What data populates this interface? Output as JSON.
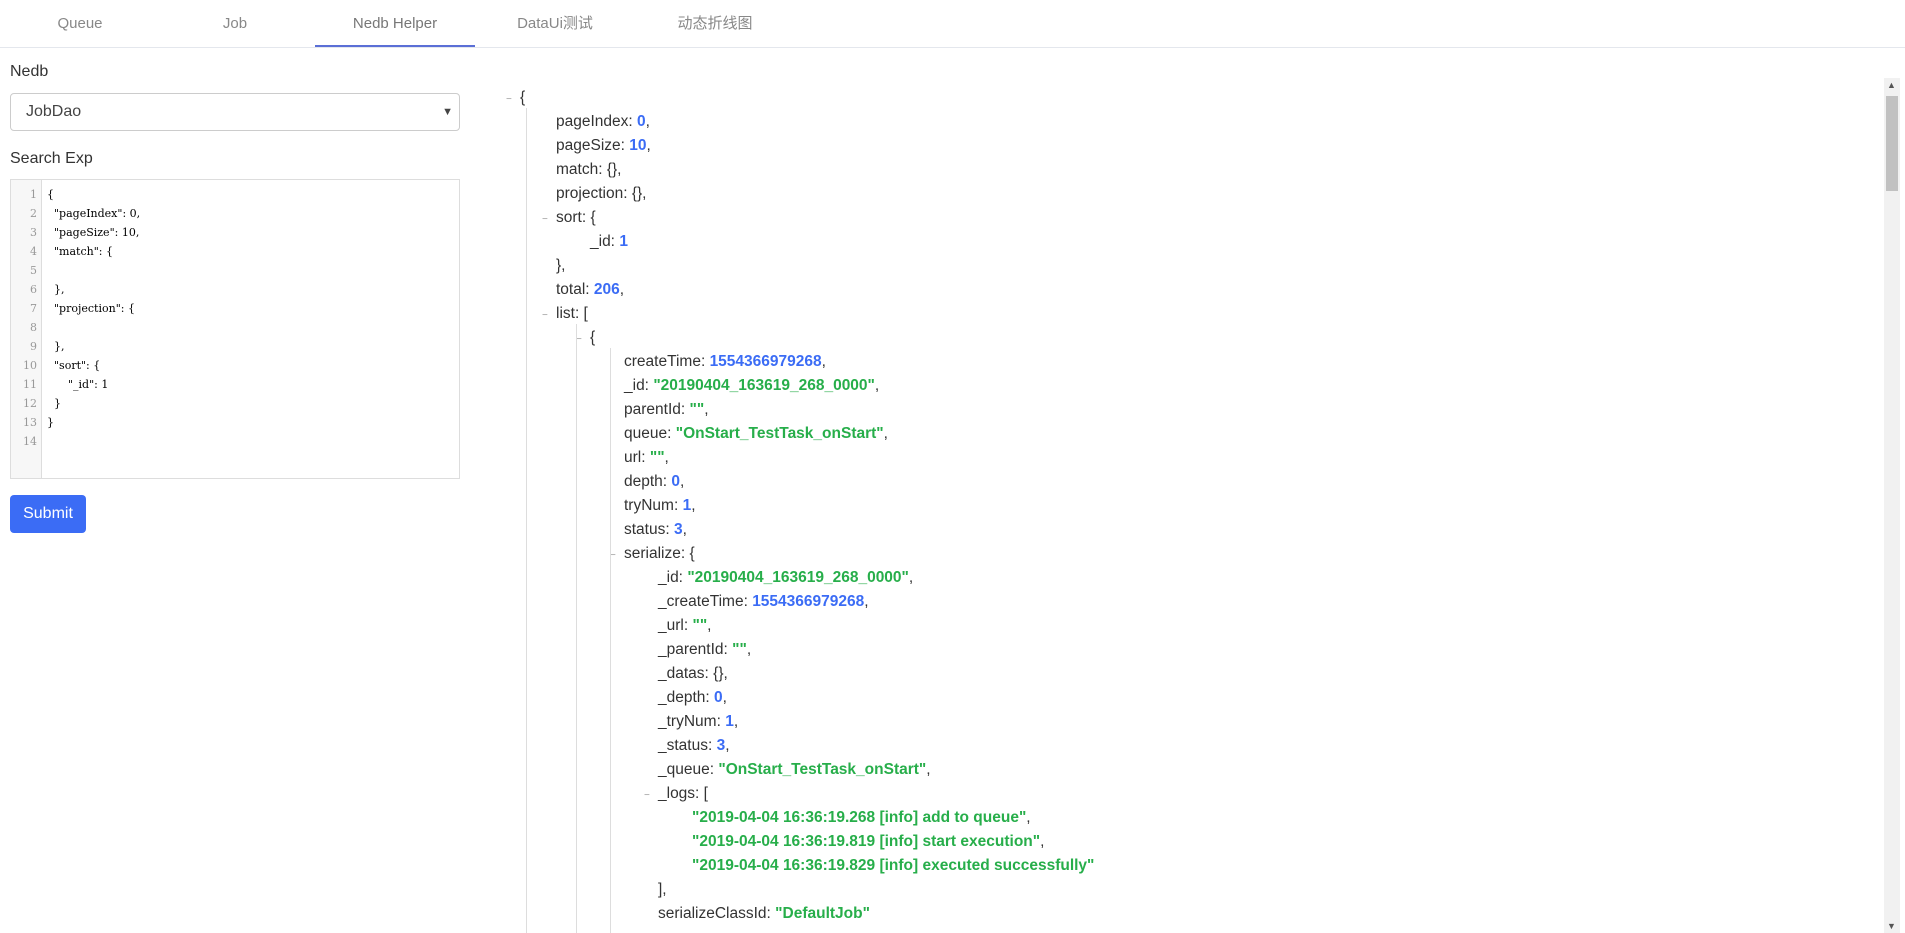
{
  "tabs": [
    {
      "label": "Queue",
      "active": false
    },
    {
      "label": "Job",
      "active": false
    },
    {
      "label": "Nedb Helper",
      "active": true
    },
    {
      "label": "DataUi测试",
      "active": false
    },
    {
      "label": "动态折线图",
      "active": false
    }
  ],
  "form": {
    "nedb_label": "Nedb",
    "nedb_value": "JobDao",
    "search_label": "Search Exp",
    "submit_label": "Submit"
  },
  "editor": {
    "lines": [
      {
        "no": "1",
        "text": "{"
      },
      {
        "no": "2",
        "text": "  \"pageIndex\": 0,"
      },
      {
        "no": "3",
        "text": "  \"pageSize\": 10,"
      },
      {
        "no": "4",
        "text": "  \"match\": {"
      },
      {
        "no": "5",
        "text": ""
      },
      {
        "no": "6",
        "text": "  },"
      },
      {
        "no": "7",
        "text": "  \"projection\": {"
      },
      {
        "no": "8",
        "text": ""
      },
      {
        "no": "9",
        "text": "  },"
      },
      {
        "no": "10",
        "text": "  \"sort\": {"
      },
      {
        "no": "11",
        "text": "      \"_id\": 1"
      },
      {
        "no": "12",
        "text": "  }"
      },
      {
        "no": "13",
        "text": "}"
      },
      {
        "no": "14",
        "text": ""
      }
    ]
  },
  "result": {
    "rows": [
      {
        "indent": 0,
        "toggle": true,
        "parts": [
          [
            "p",
            "{"
          ]
        ]
      },
      {
        "indent": 1,
        "parts": [
          [
            "p",
            "pageIndex: "
          ],
          [
            "n",
            "0"
          ],
          [
            "p",
            ","
          ]
        ]
      },
      {
        "indent": 1,
        "parts": [
          [
            "p",
            "pageSize: "
          ],
          [
            "n",
            "10"
          ],
          [
            "p",
            ","
          ]
        ]
      },
      {
        "indent": 1,
        "parts": [
          [
            "p",
            "match: {},"
          ]
        ]
      },
      {
        "indent": 1,
        "parts": [
          [
            "p",
            "projection: {},"
          ]
        ]
      },
      {
        "indent": 1,
        "toggle": true,
        "parts": [
          [
            "p",
            "sort: {"
          ]
        ]
      },
      {
        "indent": 2,
        "parts": [
          [
            "p",
            "_id: "
          ],
          [
            "n",
            "1"
          ]
        ]
      },
      {
        "indent": 1,
        "parts": [
          [
            "p",
            "},"
          ]
        ]
      },
      {
        "indent": 1,
        "parts": [
          [
            "p",
            "total: "
          ],
          [
            "n",
            "206"
          ],
          [
            "p",
            ","
          ]
        ]
      },
      {
        "indent": 1,
        "toggle": true,
        "parts": [
          [
            "p",
            "list: ["
          ]
        ]
      },
      {
        "indent": 2,
        "toggle": true,
        "parts": [
          [
            "p",
            "{"
          ]
        ]
      },
      {
        "indent": 3,
        "parts": [
          [
            "p",
            "createTime: "
          ],
          [
            "n",
            "1554366979268"
          ],
          [
            "p",
            ","
          ]
        ]
      },
      {
        "indent": 3,
        "parts": [
          [
            "p",
            "_id: "
          ],
          [
            "s",
            "\"20190404_163619_268_0000\""
          ],
          [
            "p",
            ","
          ]
        ]
      },
      {
        "indent": 3,
        "parts": [
          [
            "p",
            "parentId: "
          ],
          [
            "s",
            "\"\""
          ],
          [
            "p",
            ","
          ]
        ]
      },
      {
        "indent": 3,
        "parts": [
          [
            "p",
            "queue: "
          ],
          [
            "s",
            "\"OnStart_TestTask_onStart\""
          ],
          [
            "p",
            ","
          ]
        ]
      },
      {
        "indent": 3,
        "parts": [
          [
            "p",
            "url: "
          ],
          [
            "s",
            "\"\""
          ],
          [
            "p",
            ","
          ]
        ]
      },
      {
        "indent": 3,
        "parts": [
          [
            "p",
            "depth: "
          ],
          [
            "n",
            "0"
          ],
          [
            "p",
            ","
          ]
        ]
      },
      {
        "indent": 3,
        "parts": [
          [
            "p",
            "tryNum: "
          ],
          [
            "n",
            "1"
          ],
          [
            "p",
            ","
          ]
        ]
      },
      {
        "indent": 3,
        "parts": [
          [
            "p",
            "status: "
          ],
          [
            "n",
            "3"
          ],
          [
            "p",
            ","
          ]
        ]
      },
      {
        "indent": 3,
        "toggle": true,
        "parts": [
          [
            "p",
            "serialize: {"
          ]
        ]
      },
      {
        "indent": 4,
        "parts": [
          [
            "p",
            "_id: "
          ],
          [
            "s",
            "\"20190404_163619_268_0000\""
          ],
          [
            "p",
            ","
          ]
        ]
      },
      {
        "indent": 4,
        "parts": [
          [
            "p",
            "_createTime: "
          ],
          [
            "n",
            "1554366979268"
          ],
          [
            "p",
            ","
          ]
        ]
      },
      {
        "indent": 4,
        "parts": [
          [
            "p",
            "_url: "
          ],
          [
            "s",
            "\"\""
          ],
          [
            "p",
            ","
          ]
        ]
      },
      {
        "indent": 4,
        "parts": [
          [
            "p",
            "_parentId: "
          ],
          [
            "s",
            "\"\""
          ],
          [
            "p",
            ","
          ]
        ]
      },
      {
        "indent": 4,
        "parts": [
          [
            "p",
            "_datas: {},"
          ]
        ]
      },
      {
        "indent": 4,
        "parts": [
          [
            "p",
            "_depth: "
          ],
          [
            "n",
            "0"
          ],
          [
            "p",
            ","
          ]
        ]
      },
      {
        "indent": 4,
        "parts": [
          [
            "p",
            "_tryNum: "
          ],
          [
            "n",
            "1"
          ],
          [
            "p",
            ","
          ]
        ]
      },
      {
        "indent": 4,
        "parts": [
          [
            "p",
            "_status: "
          ],
          [
            "n",
            "3"
          ],
          [
            "p",
            ","
          ]
        ]
      },
      {
        "indent": 4,
        "parts": [
          [
            "p",
            "_queue: "
          ],
          [
            "s",
            "\"OnStart_TestTask_onStart\""
          ],
          [
            "p",
            ","
          ]
        ]
      },
      {
        "indent": 4,
        "toggle": true,
        "parts": [
          [
            "p",
            "_logs: ["
          ]
        ]
      },
      {
        "indent": 5,
        "parts": [
          [
            "s",
            "\"2019-04-04 16:36:19.268 [info] add to queue\""
          ],
          [
            "p",
            ","
          ]
        ]
      },
      {
        "indent": 5,
        "parts": [
          [
            "s",
            "\"2019-04-04 16:36:19.819 [info] start execution\""
          ],
          [
            "p",
            ","
          ]
        ]
      },
      {
        "indent": 5,
        "parts": [
          [
            "s",
            "\"2019-04-04 16:36:19.829 [info] executed successfully\""
          ]
        ]
      },
      {
        "indent": 4,
        "parts": [
          [
            "p",
            "],"
          ]
        ]
      },
      {
        "indent": 4,
        "parts": [
          [
            "p",
            "serializeClassId: "
          ],
          [
            "s",
            "\"DefaultJob\""
          ]
        ]
      }
    ]
  }
}
